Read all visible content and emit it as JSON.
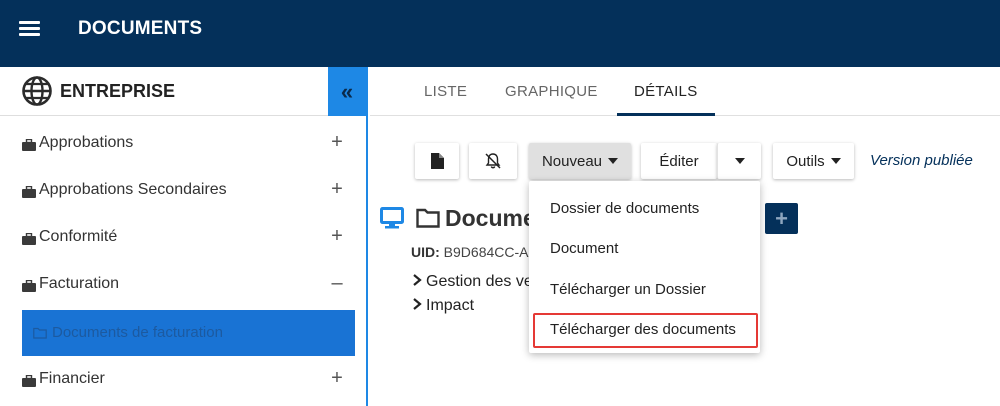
{
  "header": {
    "title": "DOCUMENTS"
  },
  "sidebar": {
    "title": "ENTREPRISE",
    "collapse_glyph": "«",
    "items": [
      {
        "label": "Approbations",
        "sign": "+"
      },
      {
        "label": "Approbations Secondaires",
        "sign": "+"
      },
      {
        "label": "Conformité",
        "sign": "+"
      },
      {
        "label": "Facturation",
        "sign": "–"
      },
      {
        "label": "Financier",
        "sign": "+"
      }
    ],
    "selected_child": {
      "label": "Documents de facturation"
    }
  },
  "tabs": [
    {
      "label": "LISTE"
    },
    {
      "label": "GRAPHIQUE"
    },
    {
      "label": "DÉTAILS",
      "active": true
    }
  ],
  "toolbar": {
    "new_label": "Nouveau",
    "edit_label": "Éditer",
    "tools_label": "Outils",
    "version_label": "Version publiée"
  },
  "document": {
    "title": "Docume",
    "uid_label": "UID:",
    "uid_value": "B9D684CC-A",
    "tree": [
      {
        "label": "Gestion des ve"
      },
      {
        "label": "Impact"
      }
    ],
    "add_glyph": "+"
  },
  "dropdown": {
    "items": [
      {
        "label": "Dossier de documents"
      },
      {
        "label": "Document"
      },
      {
        "label": "Télécharger un Dossier"
      },
      {
        "label": "Télécharger des documents",
        "highlighted": true
      }
    ]
  },
  "colors": {
    "header_bg": "#04305a",
    "accent_blue": "#1e88e5",
    "highlight_red": "#e53935"
  }
}
